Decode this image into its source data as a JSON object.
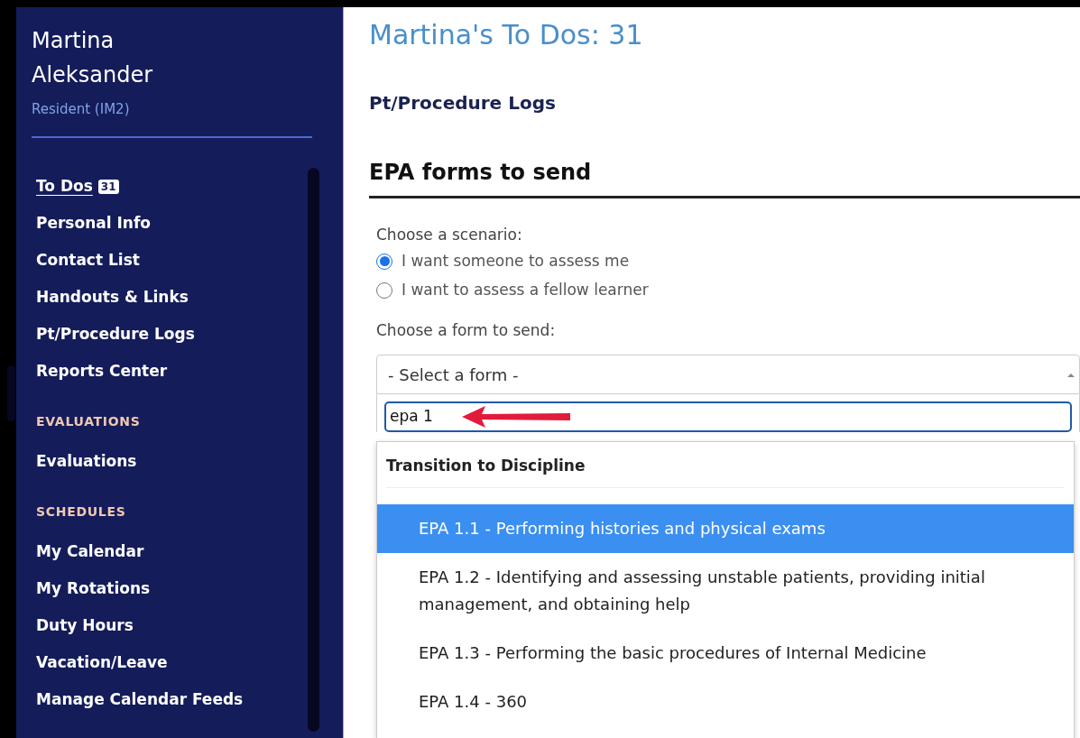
{
  "sidebar": {
    "user_name": "Martina Aleksander",
    "role": "Resident (IM2)",
    "sections": [
      {
        "items": [
          {
            "label": "To Dos",
            "badge": "31",
            "selected": true
          },
          {
            "label": "Personal Info",
            "selected": false
          },
          {
            "label": "Contact List",
            "selected": false
          },
          {
            "label": "Handouts & Links",
            "selected": false
          },
          {
            "label": "Pt/Procedure Logs",
            "selected": false
          },
          {
            "label": "Reports Center",
            "selected": false
          }
        ]
      },
      {
        "heading": "EVALUATIONS",
        "items": [
          {
            "label": "Evaluations",
            "selected": false
          }
        ]
      },
      {
        "heading": "SCHEDULES",
        "items": [
          {
            "label": "My Calendar",
            "selected": false
          },
          {
            "label": "My Rotations",
            "selected": false
          },
          {
            "label": "Duty Hours",
            "selected": false
          },
          {
            "label": "Vacation/Leave",
            "selected": false
          },
          {
            "label": "Manage Calendar Feeds",
            "selected": false
          }
        ]
      }
    ]
  },
  "main": {
    "title": "Martina's To Dos: 31",
    "subheading": "Pt/Procedure Logs",
    "section_title": "EPA forms to send",
    "scenario_label": "Choose a scenario:",
    "scenarios": [
      {
        "label": "I want someone to assess me",
        "selected": true
      },
      {
        "label": "I want to assess a fellow learner",
        "selected": false
      }
    ],
    "form_label": "Choose a form to send:",
    "select": {
      "value": "- Select a form -",
      "expanded": true,
      "search_value": "epa 1",
      "group": "Transition to Discipline",
      "options": [
        {
          "label": "EPA 1.1 - Performing histories and physical exams",
          "selected": true
        },
        {
          "label": "EPA 1.2 - Identifying and assessing unstable patients, providing initial management, and obtaining help",
          "selected": false
        },
        {
          "label": "EPA 1.3 - Performing the basic procedures of Internal Medicine",
          "selected": false
        },
        {
          "label": "EPA 1.4 - 360",
          "selected": false
        }
      ]
    }
  }
}
